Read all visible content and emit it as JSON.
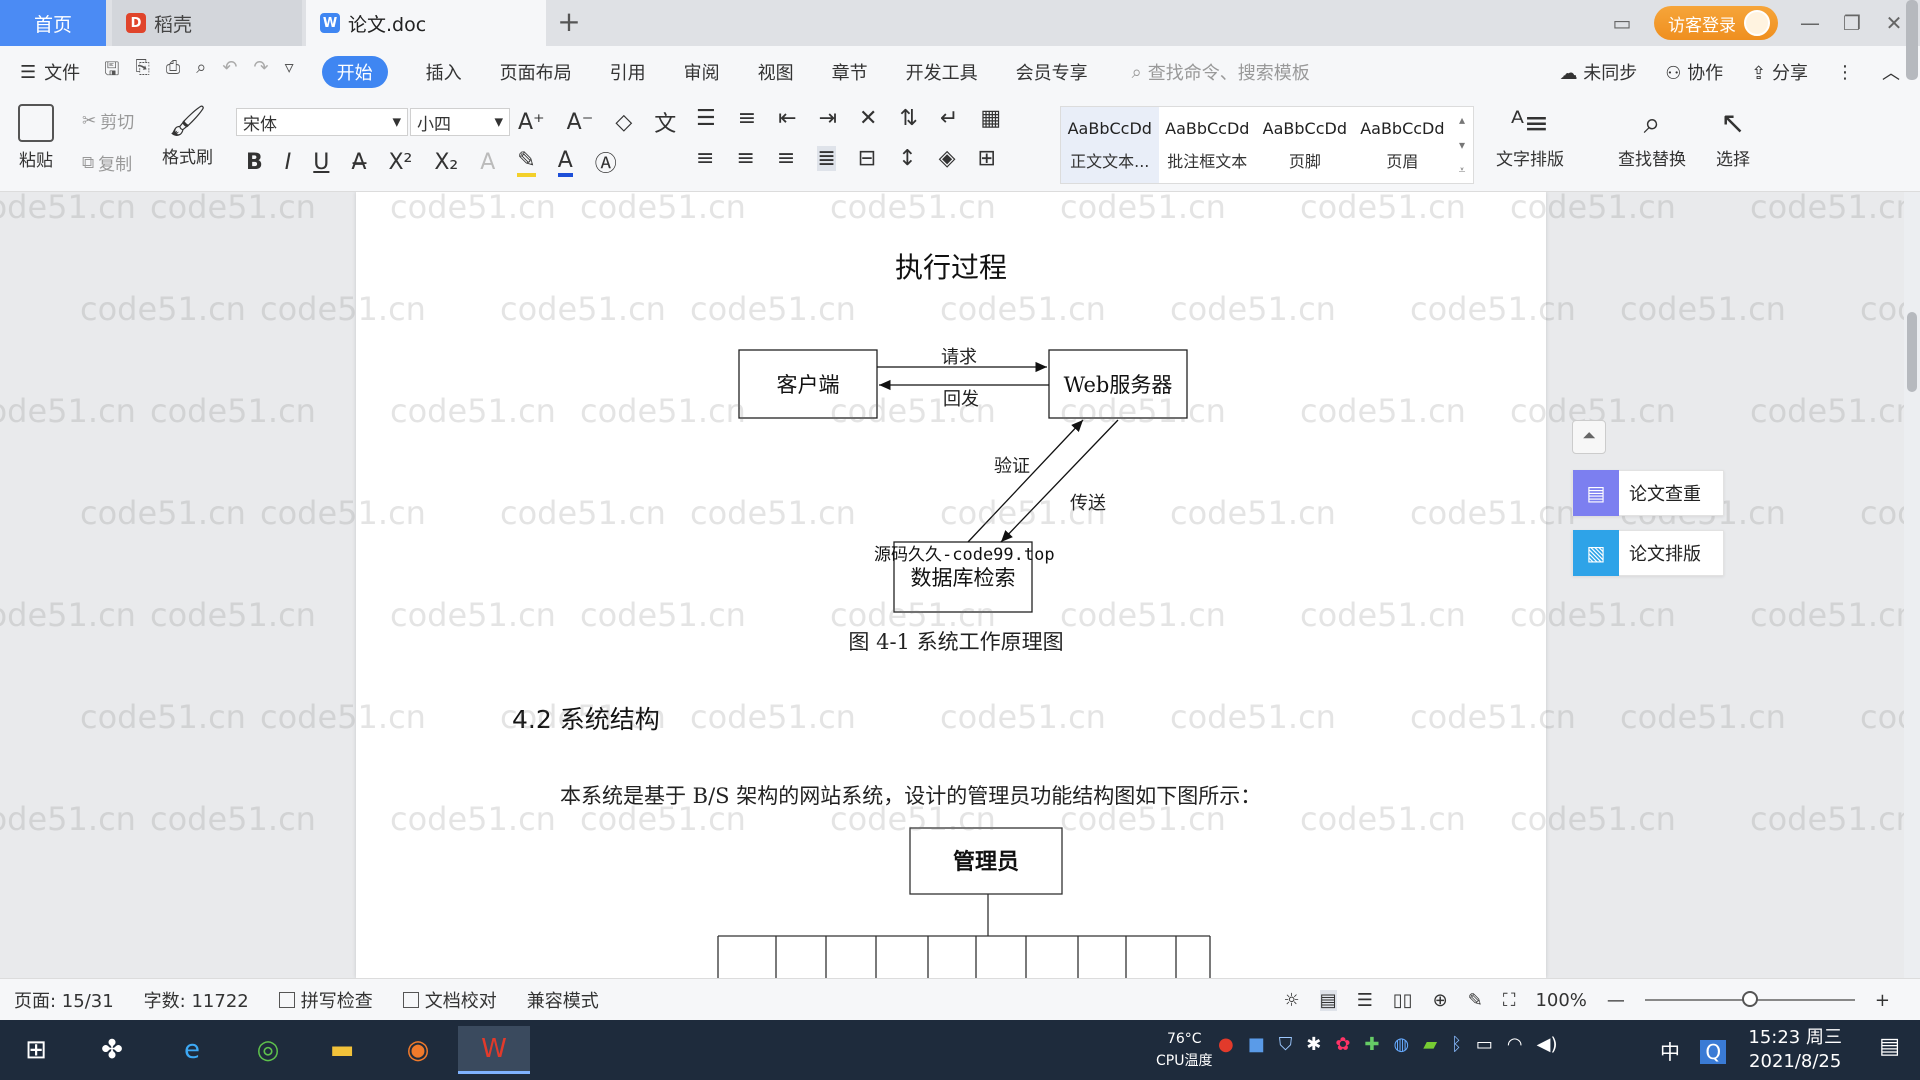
{
  "tabs": {
    "home": "首页",
    "daoke": "稻壳",
    "doc": "论文.doc"
  },
  "window": {
    "login_label": "访客登录"
  },
  "menu": {
    "file": "文件",
    "items": [
      "开始",
      "插入",
      "页面布局",
      "引用",
      "审阅",
      "视图",
      "章节",
      "开发工具",
      "会员专享"
    ],
    "search_placeholder": "查找命令、搜索模板",
    "sync": "未同步",
    "collab": "协作",
    "share": "分享"
  },
  "ribbon": {
    "paste": "粘贴",
    "cut": "剪切",
    "copy": "复制",
    "format_painter": "格式刷",
    "font_name": "宋体",
    "font_size": "小四",
    "styles": [
      {
        "preview": "AaBbCcDd",
        "label": "正文文本..."
      },
      {
        "preview": "AaBbCcDd",
        "label": "批注框文本"
      },
      {
        "preview": "AaBbCcDd",
        "label": "页脚"
      },
      {
        "preview": "AaBbCcDd",
        "label": "页眉"
      }
    ],
    "text_layout": "文字排版",
    "find_replace": "查找替换",
    "select": "选择"
  },
  "document": {
    "title": "执行过程",
    "diagram": {
      "client": "客户端",
      "server": "Web服务器",
      "database": "数据库检索",
      "request": "请求",
      "reply": "回发",
      "verify": "验证",
      "transfer": "传送"
    },
    "overlay_text": "源码久久-code99.top",
    "figure_caption": "图 4-1 系统工作原理图",
    "section_heading": "4.2 系统结构",
    "paragraph": "本系统是基于 B/S 架构的网站系统，设计的管理员功能结构图如下图所示：",
    "admin_box": "管理员",
    "watermark": "code51.cn"
  },
  "side_panel": {
    "check": "论文查重",
    "layout": "论文排版"
  },
  "status": {
    "page": "页面: 15/31",
    "words": "字数: 11722",
    "spell": "拼写检查",
    "proof": "文档校对",
    "compat": "兼容模式",
    "zoom": "100%",
    "zoom_fraction": 0.5
  },
  "taskbar": {
    "temp": "76°C",
    "temp_label": "CPU温度",
    "lang": "中",
    "time": "15:23 周三",
    "date": "2021/8/25"
  },
  "colors": {
    "accent": "#3f86f2",
    "login": "#f09a2b",
    "taskbar": "#1e2b3c"
  }
}
